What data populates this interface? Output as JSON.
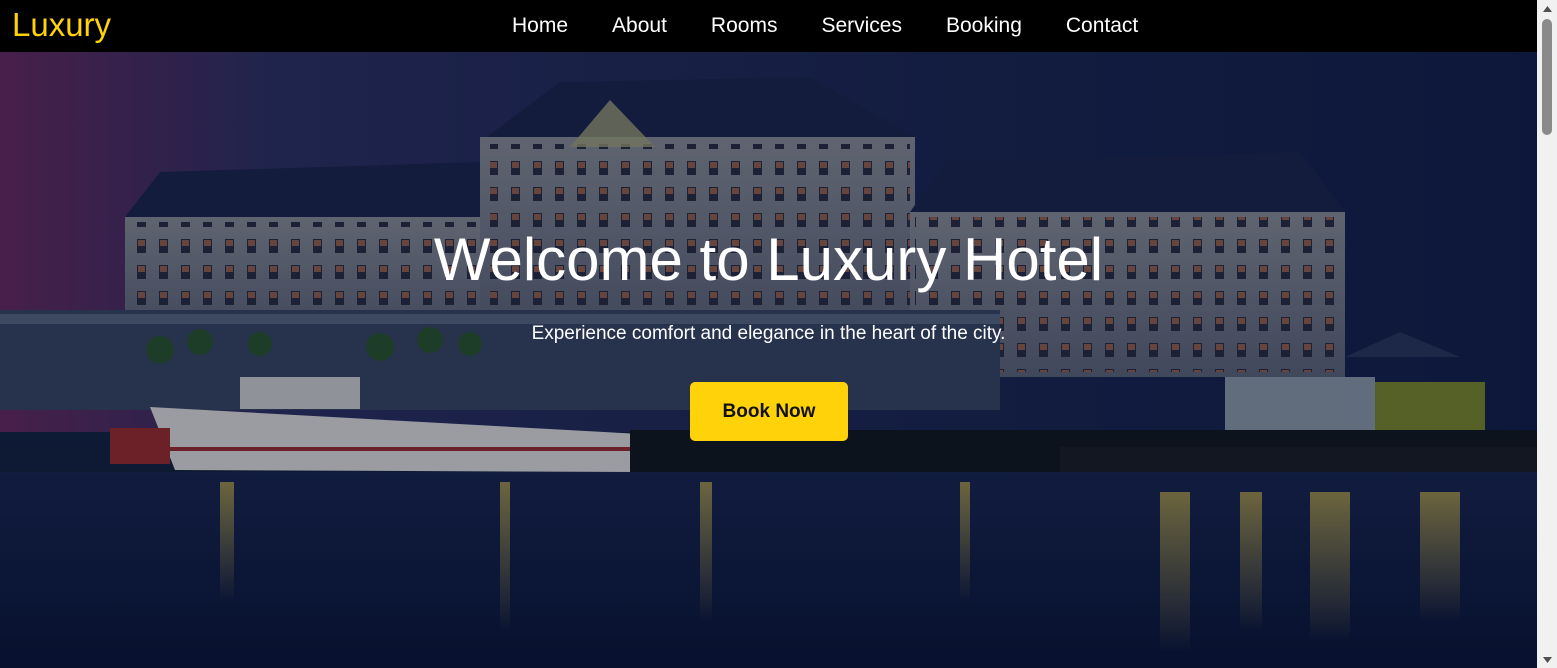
{
  "brand": {
    "name": "Luxury",
    "color": "#ffd20a"
  },
  "nav": {
    "items": [
      {
        "label": "Home"
      },
      {
        "label": "About"
      },
      {
        "label": "Rooms"
      },
      {
        "label": "Services"
      },
      {
        "label": "Booking"
      },
      {
        "label": "Contact"
      }
    ]
  },
  "hero": {
    "title": "Welcome to Luxury Hotel",
    "subtitle": "Experience comfort and elegance in the heart of the city.",
    "cta_label": "Book Now",
    "cta_color": "#ffd20a",
    "background_image": "hotel-waterfront-night-photo"
  },
  "scrollbar": {
    "up_icon": "triangle-up-icon",
    "down_icon": "triangle-down-icon"
  }
}
